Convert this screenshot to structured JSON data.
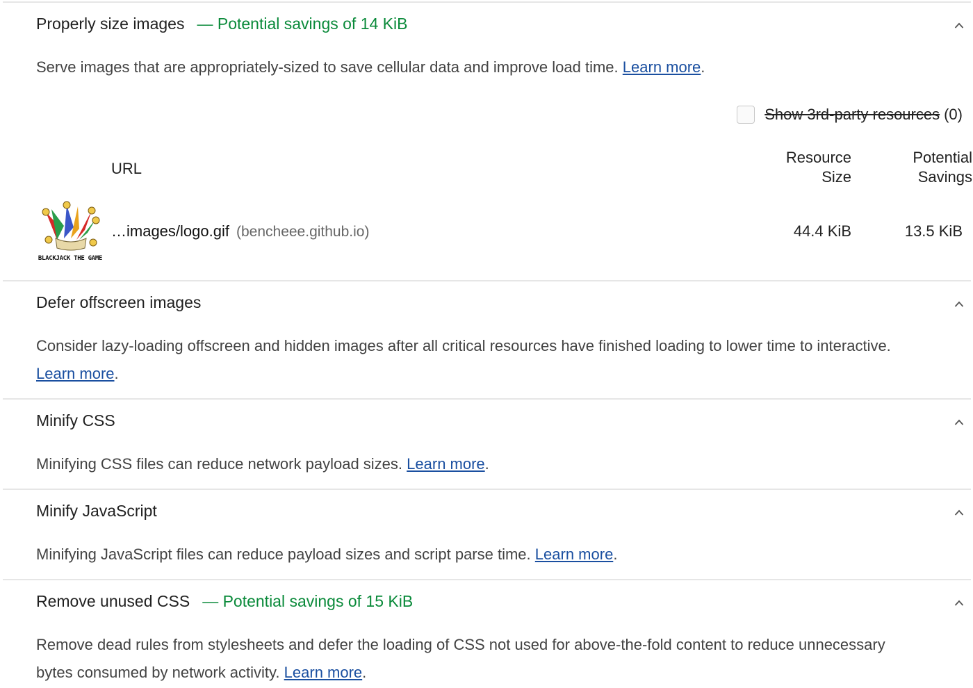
{
  "audits": [
    {
      "title": "Properly size images",
      "savings": "— Potential savings of 14 KiB",
      "description": "Serve images that are appropriately-sized to save cellular data and improve load time.",
      "learn_more": "Learn more",
      "third_party": {
        "label": "Show 3rd-party resources",
        "count": "(0)"
      },
      "table": {
        "headers": {
          "url": "URL",
          "resource_size_line1": "Resource",
          "resource_size_line2": "Size",
          "potential_savings_line1": "Potential",
          "potential_savings_line2": "Savings"
        },
        "rows": [
          {
            "thumb_caption": "BLACKJACK THE GAME",
            "url": "…images/logo.gif",
            "host": "(bencheee.github.io)",
            "resource_size": "44.4 KiB",
            "potential_savings": "13.5 KiB"
          }
        ]
      }
    },
    {
      "title": "Defer offscreen images",
      "description": "Consider lazy-loading offscreen and hidden images after all critical resources have finished loading to lower time to interactive.",
      "learn_more": "Learn more"
    },
    {
      "title": "Minify CSS",
      "description": "Minifying CSS files can reduce network payload sizes.",
      "learn_more": "Learn more"
    },
    {
      "title": "Minify JavaScript",
      "description": "Minifying JavaScript files can reduce payload sizes and script parse time.",
      "learn_more": "Learn more"
    },
    {
      "title": "Remove unused CSS",
      "savings": "— Potential savings of 15 KiB",
      "description": "Remove dead rules from stylesheets and defer the loading of CSS not used for above-the-fold content to reduce unnecessary bytes consumed by network activity.",
      "learn_more": "Learn more"
    }
  ],
  "colors": {
    "savings": "#0a8a3a",
    "link": "#1a4fa0",
    "divider": "#e6e6e6"
  },
  "icons": {
    "chevron": "chevron-up-icon",
    "checkbox": "checkbox-unchecked"
  }
}
